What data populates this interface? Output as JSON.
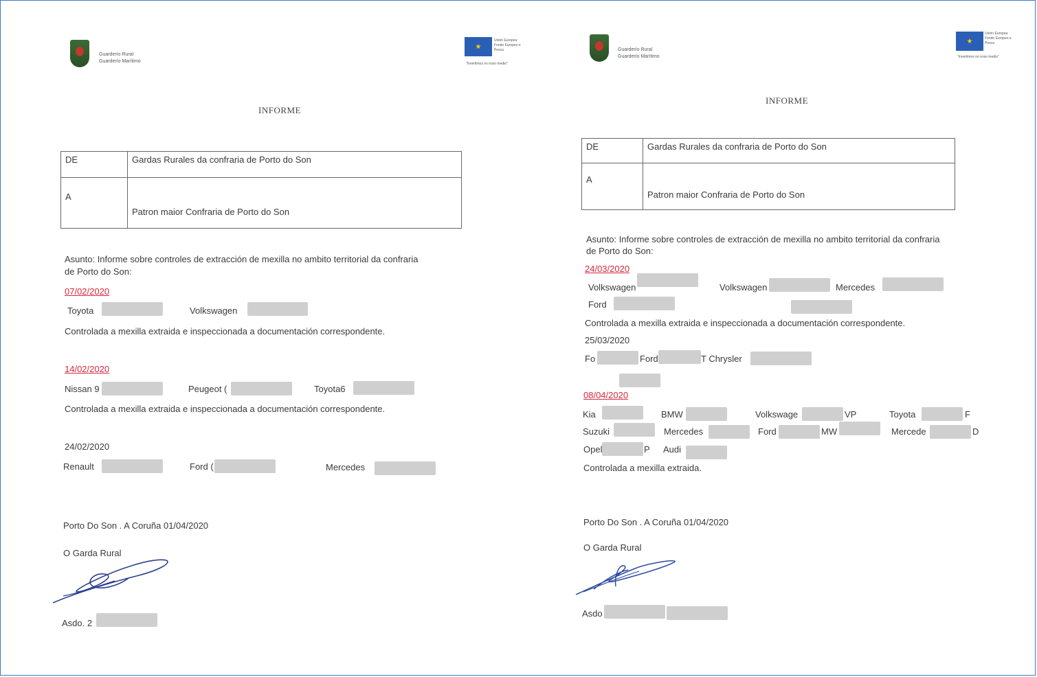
{
  "documents": [
    {
      "org_line1": "Guarderío Rural",
      "org_line2": "Guarderío Marítimo",
      "eu_lines": [
        "Unión Europea",
        "Fondo Europeo e",
        "Pesca"
      ],
      "eu_tag": "\"Invertimos no noso medio\"",
      "title": "INFORME",
      "de_label": "DE",
      "de_value": "Gardas Rurales da confraria de Porto do Son",
      "a_label": "A",
      "a_value": "Patron maior Confraria de Porto do Son",
      "asunto_line1": "Asunto:   Informe sobre controles de extracción de mexilla no ambito territorial da confraria",
      "asunto_line2": "de Porto do Son:",
      "entries": {
        "d1": "07/02/2020",
        "d1_cars": [
          "Toyota",
          "Volkswagen"
        ],
        "d1_note": "Controlada a mexilla extraida e inspeccionada a documentación correspondente.",
        "d2": "14/02/2020",
        "d2_cars": [
          "Nissan 9",
          "Peugeot (",
          "Toyota6"
        ],
        "d2_note": "Controlada a mexilla extraida e inspeccionada a documentación correspondente.",
        "d3": "24/02/2020",
        "d3_cars": [
          "Renault",
          "Ford (",
          "Mercedes"
        ]
      },
      "place_date": "Porto Do Son . A Coruña   01/04/2020",
      "signer": "O  Garda Rural",
      "asdo": "Asdo. 2"
    },
    {
      "org_line1": "Guarderío Rural",
      "org_line2": "Guarderío Marítimo",
      "eu_lines": [
        "Unión Europea",
        "Fondo Europeo e",
        "Pesca"
      ],
      "eu_tag": "\"Invertimos no noso medio\"",
      "title": "INFORME",
      "de_label": "DE",
      "de_value": "Gardas Rurales da confraria de Porto do Son",
      "a_label": "A",
      "a_value": "Patron maior Confraria de Porto do Son",
      "asunto_line1": "Asunto:   Informe sobre controles de extracción de mexilla no ambito territorial da confraria",
      "asunto_line2": "de Porto do Son:",
      "entries": {
        "d1": "24/03/2020",
        "d1_cars": [
          "Volkswagen",
          "Volkswagen",
          "Mercedes",
          "Ford"
        ],
        "d1_note": "Controlada a mexilla extraida e inspeccionada a documentación correspondente.",
        "d2": "25/03/2020",
        "d2_cars": [
          "Fo",
          "Ford",
          "T   Chrysler"
        ],
        "d3": "08/04/2020",
        "d3_row1": [
          "Kia",
          "BMW",
          "Volkswage",
          "VP",
          "Toyota",
          "F"
        ],
        "d3_row2": [
          "Suzuki",
          "Mercedes",
          "Ford",
          "MW",
          "Mercede",
          "D"
        ],
        "d3_row3": [
          "Opel",
          "P",
          "Audi"
        ],
        "d3_note": "Controlada a mexilla extraida."
      },
      "place_date": "Porto Do Son . A Coruña   01/04/2020",
      "signer": "O  Garda Rural",
      "asdo": "Asdo"
    }
  ]
}
